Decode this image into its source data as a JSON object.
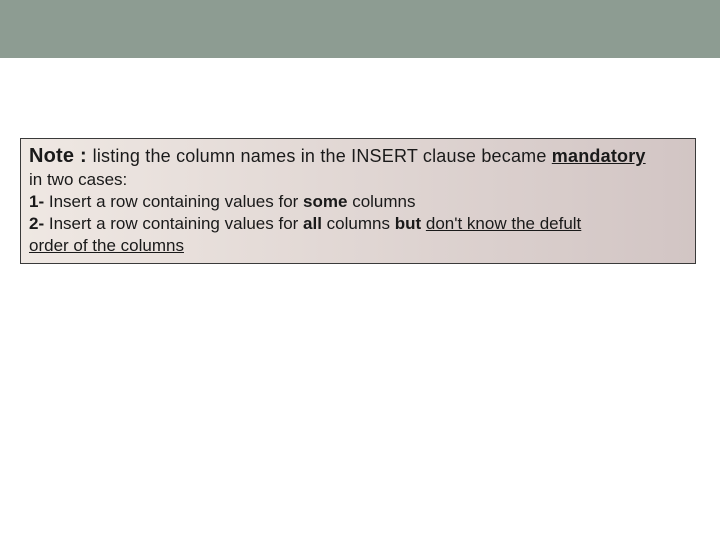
{
  "note": {
    "label": "Note : ",
    "intro_before": "listing the column names in the INSERT clause became ",
    "intro_mandatory": "mandatory",
    "line2": "in two cases:",
    "item1_num": "1-",
    "item1_before": " Insert a row containing values for ",
    "item1_bold": "some",
    "item1_after": " columns",
    "item2_num": "2-",
    "item2_before": " Insert a row containing values for ",
    "item2_bold1": "all",
    "item2_mid": " columns ",
    "item2_bold2": "but",
    "item2_after": " ",
    "item2_underlined_a": "don't know the defult",
    "item2_underlined_b": "order of the columns"
  }
}
